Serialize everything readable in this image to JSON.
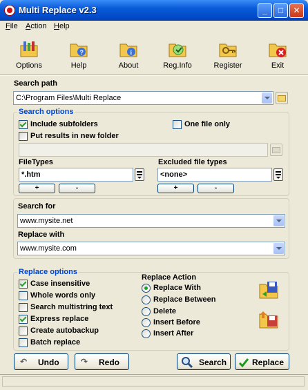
{
  "window": {
    "title": "Multi Replace v2.3"
  },
  "menu": [
    {
      "label": "File",
      "accel": "F",
      "rest": "ile"
    },
    {
      "label": "Action",
      "accel": "A",
      "rest": "ction"
    },
    {
      "label": "Help",
      "accel": "H",
      "rest": "elp"
    }
  ],
  "toolbar": {
    "options": "Options",
    "help": "Help",
    "about": "About",
    "reginfo": "Reg.Info",
    "register": "Register",
    "exit": "Exit"
  },
  "search_path": {
    "label": "Search path",
    "value": "C:\\Program Files\\Multi Replace"
  },
  "search_options": {
    "title": "Search options",
    "include_subfolders": {
      "label": "Include subfolders",
      "checked": true
    },
    "one_file_only": {
      "label": "One file only",
      "checked": false
    },
    "put_results": {
      "label": "Put results in new folder",
      "checked": false
    },
    "result_folder_value": "",
    "filetypes_label": "FileTypes",
    "filetypes_value": "*.htm",
    "excluded_label": "Excluded file types",
    "excluded_value": "<none>",
    "plus": "+",
    "minus": "-"
  },
  "search_for": {
    "label": "Search for",
    "value": "www.mysite.net"
  },
  "replace_with": {
    "label": "Replace with",
    "value": "www.mysite.com"
  },
  "replace_options": {
    "title": "Replace options",
    "items": [
      {
        "label": "Case insensitive",
        "checked": true
      },
      {
        "label": "Whole words only",
        "checked": false
      },
      {
        "label": "Search multistring text",
        "checked": false
      },
      {
        "label": "Express replace",
        "checked": true
      },
      {
        "label": "Create autobackup",
        "checked": false
      },
      {
        "label": "Batch replace",
        "checked": false
      }
    ]
  },
  "replace_action": {
    "title": "Replace Action",
    "items": [
      {
        "label": "Replace With",
        "selected": true
      },
      {
        "label": "Replace Between",
        "selected": false
      },
      {
        "label": "Delete",
        "selected": false
      },
      {
        "label": "Insert Before",
        "selected": false
      },
      {
        "label": "Insert After",
        "selected": false
      }
    ]
  },
  "buttons": {
    "undo": "Undo",
    "redo": "Redo",
    "search": "Search",
    "replace": "Replace"
  },
  "colors": {
    "titlebar": "#0A5BD8",
    "group_title": "#0046D5",
    "check": "#21A121"
  }
}
